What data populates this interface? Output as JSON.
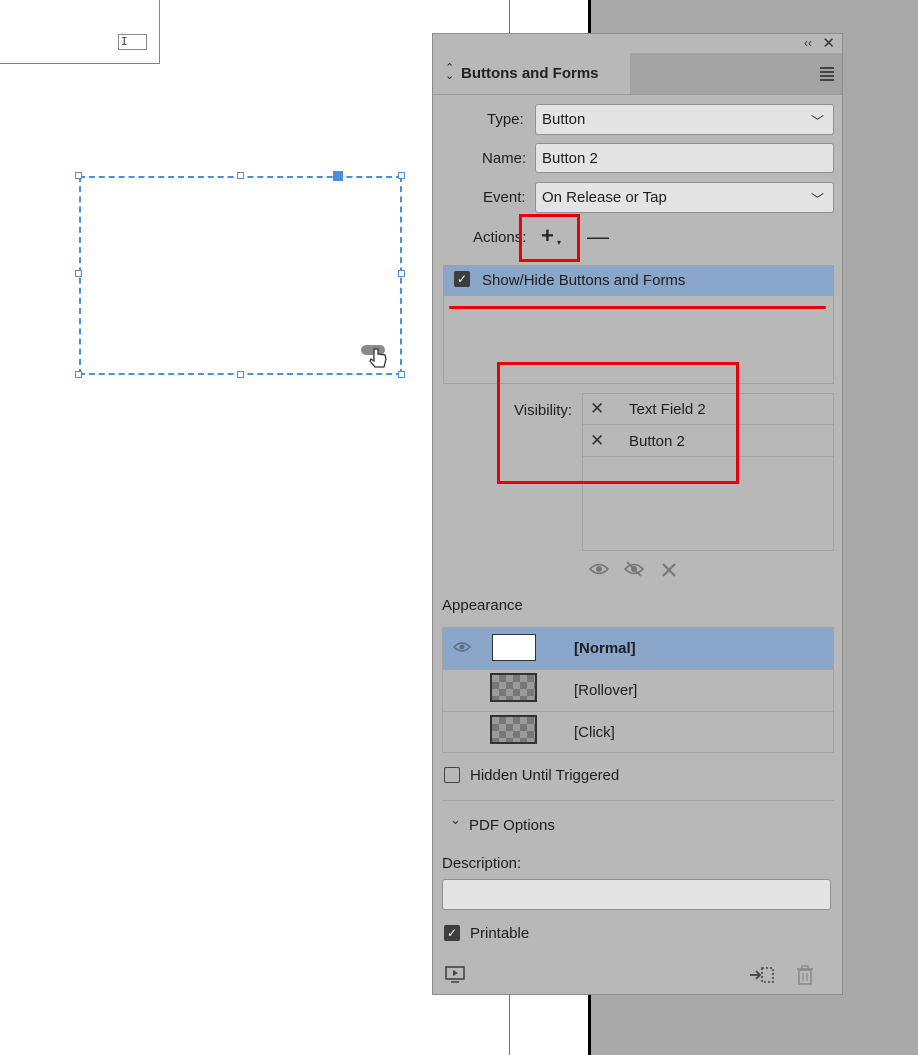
{
  "canvas": {
    "textframe_icon_glyph": "I",
    "hand_icon_glyph": "☝"
  },
  "panel": {
    "title": "Buttons and Forms",
    "collapse_glyph": "‹‹",
    "close_glyph": "✕",
    "type_label": "Type:",
    "type_value": "Button",
    "name_label": "Name:",
    "name_value": "Button 2",
    "event_label": "Event:",
    "event_value": "On Release or Tap",
    "actions_label": "Actions:",
    "add_action_glyph": "+",
    "remove_action_glyph": "—",
    "actions": [
      {
        "label": "Show/Hide Buttons and Forms",
        "checked": true
      }
    ],
    "visibility_label": "Visibility:",
    "visibility_items": [
      {
        "state_glyph": "✕",
        "label": "Text Field 2"
      },
      {
        "state_glyph": "✕",
        "label": "Button 2"
      }
    ],
    "visibility_tool_icons": [
      "eye-icon",
      "eye-slash-icon",
      "close-icon"
    ],
    "appearance_label": "Appearance",
    "appearance_states": [
      {
        "label": "[Normal]",
        "selected": true
      },
      {
        "label": "[Rollover]",
        "selected": false
      },
      {
        "label": "[Click]",
        "selected": false
      }
    ],
    "hidden_until_triggered_label": "Hidden Until Triggered",
    "hidden_until_triggered_checked": false,
    "pdf_options_label": "PDF Options",
    "description_label": "Description:",
    "description_value": "",
    "printable_label": "Printable",
    "printable_checked": true
  },
  "colors": {
    "panel_bg": "#b8b8b8",
    "selection": "#8aa6c8",
    "annotation_red": "#e8000b",
    "frame_blue": "#4a90d9"
  }
}
